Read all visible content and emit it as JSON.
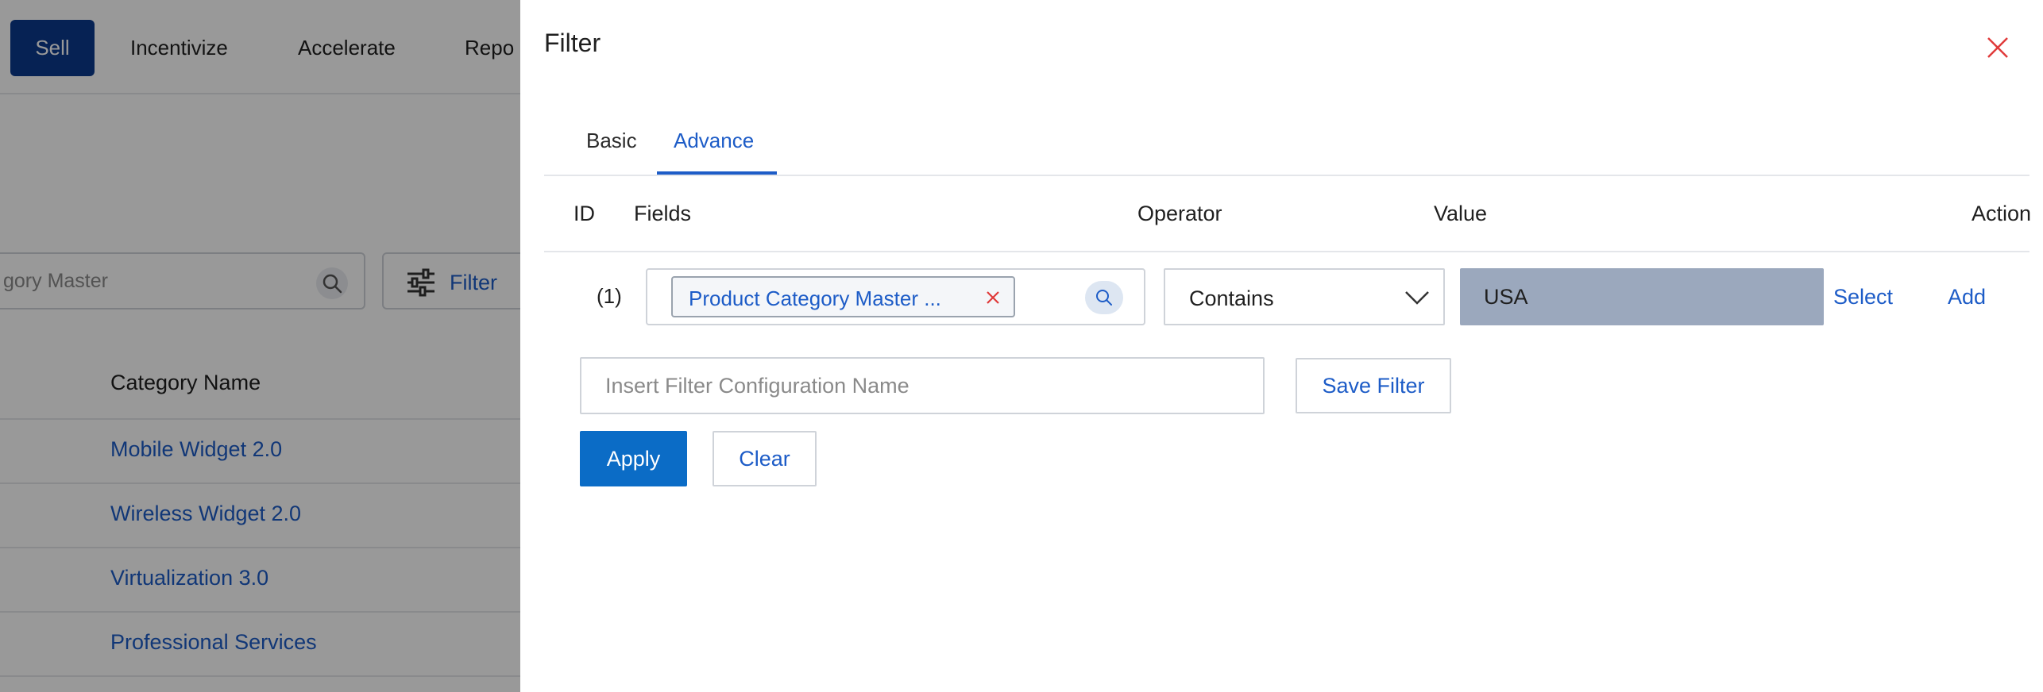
{
  "background": {
    "nav": {
      "sell": "Sell",
      "incentivize": "Incentivize",
      "accelerate": "Accelerate",
      "reports": "Repo"
    },
    "search": {
      "value": "gory Master"
    },
    "filter_button": "Filter",
    "table": {
      "column_header": "Category Name",
      "rows": [
        "Mobile Widget 2.0",
        "Wireless Widget 2.0",
        "Virtualization 3.0",
        "Professional Services"
      ]
    }
  },
  "panel": {
    "title": "Filter",
    "tabs": {
      "basic": "Basic",
      "advance": "Advance",
      "active": "Advance"
    },
    "columns": {
      "id": "ID",
      "fields": "Fields",
      "operator": "Operator",
      "value": "Value",
      "action": "Action"
    },
    "row": {
      "id": "(1)",
      "field_chip": "Product Category Master ...",
      "operator": "Contains",
      "value": "USA",
      "select_link": "Select",
      "add_link": "Add"
    },
    "config_name": {
      "placeholder": "Insert Filter Configuration Name",
      "value": ""
    },
    "buttons": {
      "save": "Save Filter",
      "apply": "Apply",
      "clear": "Clear"
    }
  },
  "colors": {
    "accent_blue": "#1d5cc7",
    "primary_button": "#0b6cc6",
    "nav_active": "#0b3a8c",
    "value_box": "#9ba8bd",
    "close_icon": "#e03a3a"
  },
  "icons": [
    "search-icon",
    "filter-sliders-icon",
    "close-icon",
    "chip-remove-icon",
    "chevron-down-icon"
  ]
}
